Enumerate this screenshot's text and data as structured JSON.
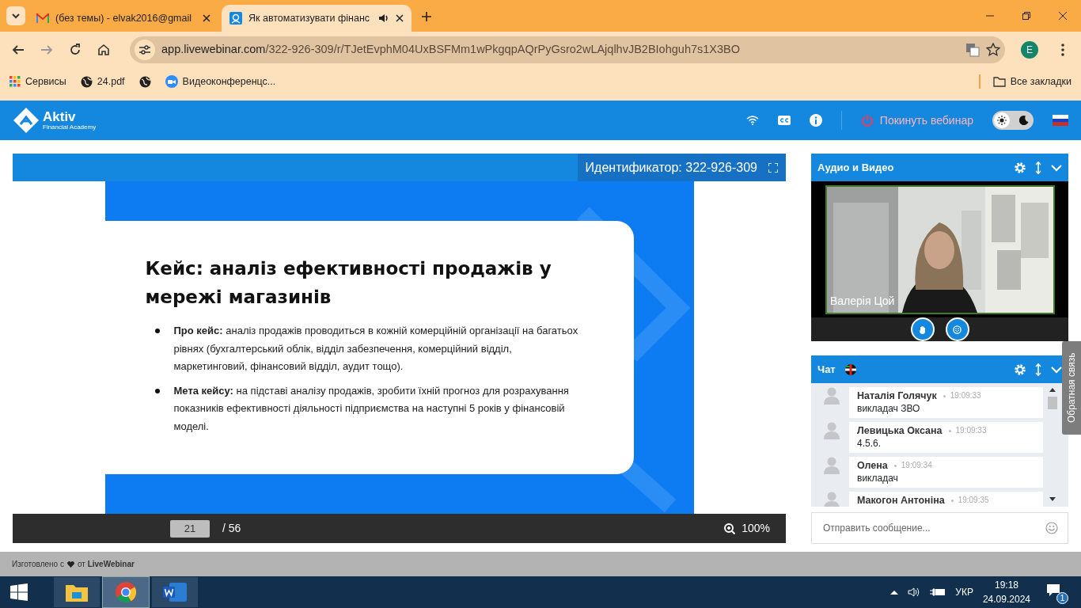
{
  "browser": {
    "tabs": [
      {
        "kind": "mail",
        "title": "(без темы) - elvak2016@gmail",
        "selected": false
      },
      {
        "kind": "webinar",
        "title": "Як автоматизувати фінанс",
        "selected": true,
        "audio": true
      }
    ],
    "url_host": "app.livewebinar.com",
    "url_path": "/322-926-309/r/TJetEvphM04UxBSFMm1wPkgqpAQrPyGsro2wLAjqlhvJB2BIohguh7s1X3BO",
    "profile": "E",
    "bookmarks": [
      {
        "kind": "apps",
        "label": "Сервисы"
      },
      {
        "kind": "globe",
        "label": "24.pdf"
      },
      {
        "kind": "globe"
      },
      {
        "kind": "zoom",
        "label": "Видеоконференцс..."
      }
    ],
    "all_bookmarks": "Все закладки"
  },
  "app": {
    "logo": "Aktiv",
    "logo_sub": "Financial Academy",
    "leave": "Покинуть вебинар",
    "dark_mode": false
  },
  "presentation": {
    "identifier": "Идентификатор: 322-926-309",
    "slide_title": "Кейс: аналіз ефективності продажів у мережі магазинів",
    "bullets": [
      "**Про кейс:** аналіз продажів проводиться в кожній комерційній організації на багатьох рівнях (бухгалтерський облік, відділ забезпечення, комерційний відділ, маркетинговий, фінансовий відділ, аудит тощо).",
      "**Мета кейсу:** на підставі аналізу продажів, зробити їхній прогноз для розрахування показників ефективності діяльності підприємства на наступні 5 років у фінансовій моделі."
    ],
    "page": "21",
    "total": "/ 56",
    "zoom": "100%"
  },
  "av_panel": {
    "title": "Аудио и Видео",
    "speaker": "Валерія Цой"
  },
  "chat": {
    "title": "Чат",
    "messages": [
      {
        "author": "Наталія Голячук",
        "time": "19:09:33",
        "text": "викладач ЗВО"
      },
      {
        "author": "Левицька Оксана",
        "time": "19:09:33",
        "text": "4.5.6."
      },
      {
        "author": "Олена",
        "time": "19:09:34",
        "text": "викладач"
      },
      {
        "author": "Макогон Антоніна",
        "time": "19:09:35"
      }
    ],
    "placeholder": "Отправить сообщение..."
  },
  "feedback_tab": "Обратная связь",
  "footer": {
    "before": "Изготовлено с",
    "after": "от **LiveWebinar**"
  },
  "taskbar": {
    "apps": [
      {
        "kind": "explorer",
        "selected": false
      },
      {
        "kind": "chrome",
        "selected": true
      },
      {
        "kind": "word",
        "selected": false
      }
    ],
    "language": "УКР",
    "time": "19:18",
    "date": "24.09.2024",
    "notifications": "1"
  }
}
